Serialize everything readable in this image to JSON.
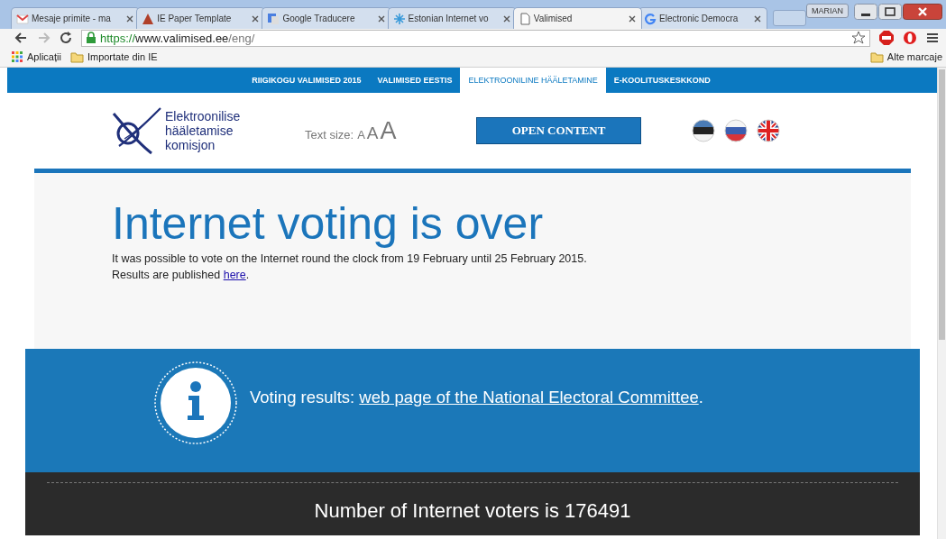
{
  "browser": {
    "tabs": [
      {
        "kind": "mail",
        "title": "Mesaje primite - ma",
        "selected": false
      },
      {
        "kind": "triangle",
        "title": "IE Paper Template",
        "selected": false
      },
      {
        "kind": "translate",
        "title": "Google Traducere",
        "selected": false
      },
      {
        "kind": "snowflake",
        "title": "Estonian Internet vo",
        "selected": false
      },
      {
        "kind": "page",
        "title": "Valimised",
        "selected": true
      },
      {
        "kind": "g",
        "title": "Electronic Democra",
        "selected": false
      }
    ],
    "user": "MARIAN",
    "url": {
      "scheme": "https://",
      "host": "www.valimised.ee",
      "path": "/eng/"
    },
    "bookmarks": [
      {
        "kind": "apps",
        "label": "Aplicații"
      },
      {
        "kind": "folder",
        "label": "Importate din IE"
      }
    ],
    "other_bookmarks": "Alte marcaje"
  },
  "nav": [
    {
      "label": "RIIGIKOGU VALIMISED 2015",
      "selected": false
    },
    {
      "label": "VALIMISED EESTIS",
      "selected": false
    },
    {
      "label": "ELEKTROONILINE HÄÄLETAMINE",
      "selected": true
    },
    {
      "label": "E-KOOLITUSKESKKOND",
      "selected": false
    }
  ],
  "header": {
    "logo_text": "Elektroonilise\nhääletamise\nkomisjon",
    "text_size_label": "Text size:",
    "text_sizes": [
      "A",
      "A",
      "A"
    ],
    "button": "OPEN CONTENT",
    "flags": [
      {
        "kind": "estonian"
      },
      {
        "kind": "russian"
      },
      {
        "kind": "british"
      }
    ]
  },
  "hero": {
    "title": "Internet voting is over",
    "text": "It was possible to vote on the Internet round the clock from 19 February until 25 February 2015.",
    "results": {
      "before": "Results are published ",
      "link": "here",
      "after": "."
    }
  },
  "results_band": {
    "before": "Voting results: ",
    "link": "web page of the National Electoral Committee",
    "after": "."
  },
  "voters": "Number of Internet voters is 176491"
}
